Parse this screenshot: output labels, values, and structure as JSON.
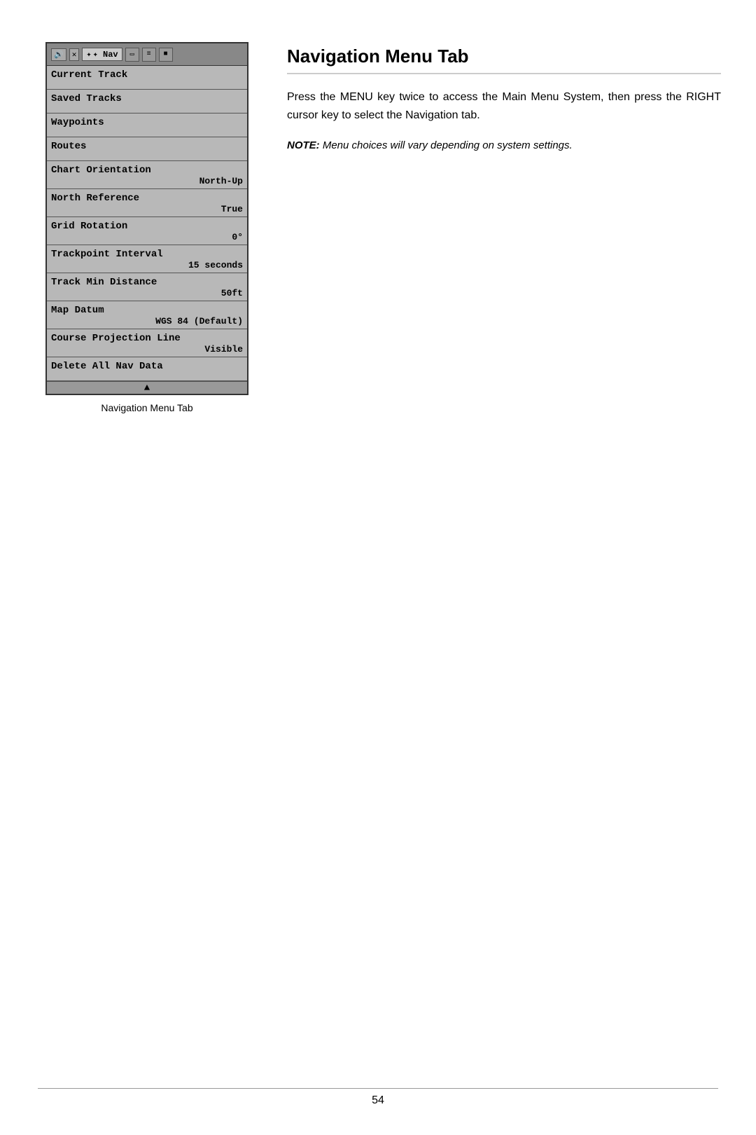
{
  "page": {
    "number": "54"
  },
  "caption": {
    "text": "Navigation Menu Tab"
  },
  "page_title": "Navigation Menu Tab",
  "description": "Press the MENU key twice to access the Main Menu System, then press the RIGHT cursor key to select the Navigation tab.",
  "note": {
    "label": "NOTE:",
    "text": " Menu choices will vary depending on system settings."
  },
  "toolbar": {
    "icons": [
      "🔊",
      "✕",
      "✦ Nav",
      "▭",
      "≡",
      "🔲"
    ]
  },
  "menu_items": [
    {
      "label": "Current Track",
      "value": ""
    },
    {
      "label": "Saved Tracks",
      "value": ""
    },
    {
      "label": "Waypoints",
      "value": ""
    },
    {
      "label": "Routes",
      "value": ""
    },
    {
      "label": "Chart Orientation",
      "value": "North-Up"
    },
    {
      "label": "North Reference",
      "value": "True"
    },
    {
      "label": "Grid Rotation",
      "value": "0°"
    },
    {
      "label": "Trackpoint Interval",
      "value": "15 seconds"
    },
    {
      "label": "Track Min Distance",
      "value": "50ft"
    },
    {
      "label": "Map Datum",
      "value": "WGS 84 (Default)"
    },
    {
      "label": "Course Projection Line",
      "value": "Visible"
    },
    {
      "label": "Delete All Nav Data",
      "value": ""
    }
  ]
}
